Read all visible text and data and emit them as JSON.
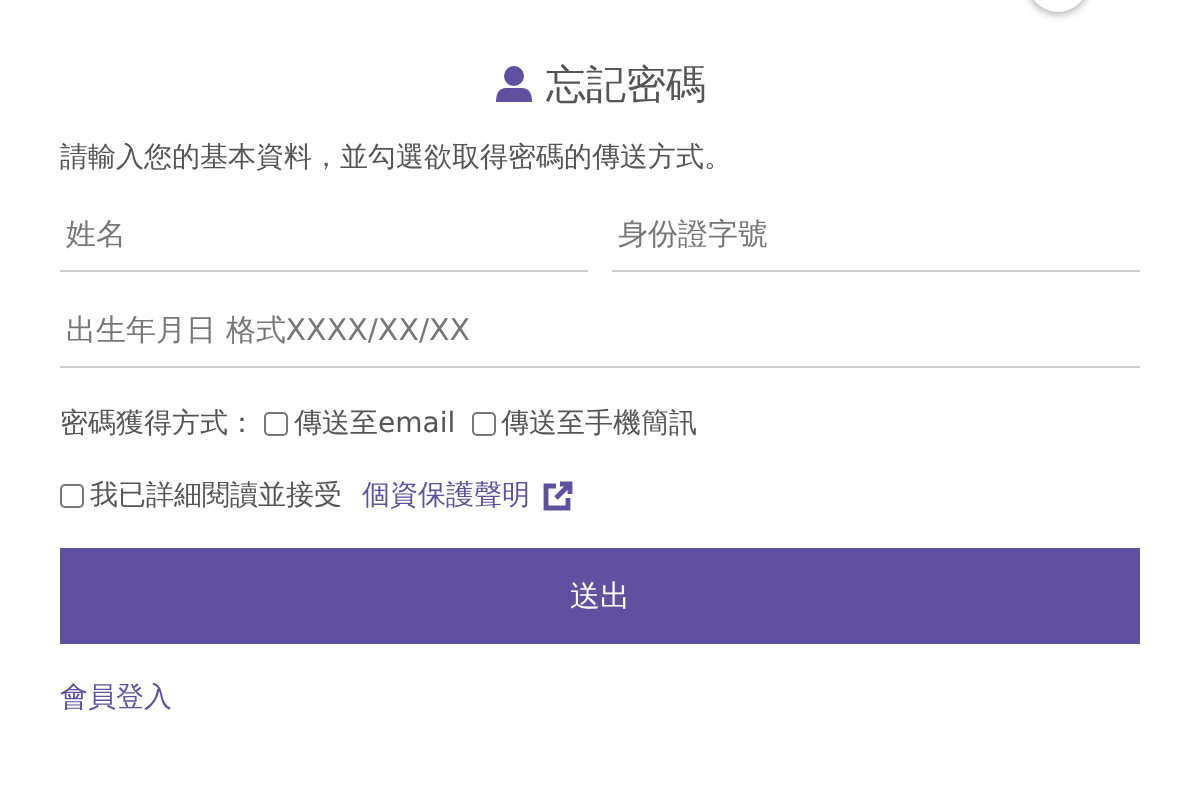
{
  "title": "忘記密碼",
  "instructions": "請輸入您的基本資料，並勾選欲取得密碼的傳送方式。",
  "fields": [
    {
      "placeholder": "姓名"
    },
    {
      "placeholder": "身份證字號"
    },
    {
      "placeholder": "出生年月日 格式XXXX/XX/XX"
    }
  ],
  "delivery": {
    "label": "密碼獲得方式：",
    "options": [
      {
        "label": "傳送至email",
        "checked": false
      },
      {
        "label": "傳送至手機簡訊",
        "checked": false
      }
    ]
  },
  "agreement": {
    "label": "我已詳細閱讀並接受",
    "checked": false,
    "link": "個資保護聲明"
  },
  "submit": "送出",
  "login_link": "會員登入"
}
